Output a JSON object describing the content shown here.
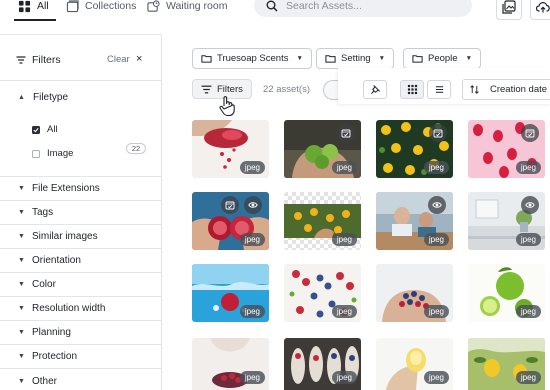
{
  "topbar": {
    "tabs": [
      {
        "label": "All",
        "icon": "grid-icon",
        "active": true
      },
      {
        "label": "Collections",
        "icon": "collections-icon"
      },
      {
        "label": "Waiting room",
        "icon": "waiting-room-icon"
      }
    ],
    "search_placeholder": "Search Assets...",
    "actions": [
      "gallery-icon",
      "cloud-upload-icon"
    ]
  },
  "sidebar": {
    "title": "Filters",
    "clear_label": "Clear",
    "close_symbol": "×",
    "filetype": {
      "label": "Filetype",
      "options": [
        {
          "label": "All",
          "checked": true
        },
        {
          "label": "Image",
          "checked": false,
          "count": "22"
        }
      ]
    },
    "items": [
      {
        "label": "File Extensions"
      },
      {
        "label": "Tags"
      },
      {
        "label": "Similar images"
      },
      {
        "label": "Orientation"
      },
      {
        "label": "Color"
      },
      {
        "label": "Resolution width"
      },
      {
        "label": "Planning"
      },
      {
        "label": "Protection"
      },
      {
        "label": "Other"
      }
    ]
  },
  "toolbar": {
    "collection_filters": [
      {
        "label": "Truesoap Scents"
      },
      {
        "label": "Setting"
      },
      {
        "label": "People"
      }
    ],
    "filters_button": "Filters",
    "asset_count": "22 asset(s)",
    "sort_label": "Creation date"
  },
  "grid": {
    "tiles": [
      {
        "badge": "jpeg",
        "subject": "pomegranate-seeds",
        "icons": []
      },
      {
        "badge": "jpeg",
        "subject": "limes-in-hands",
        "icons": [
          "calendar-check-icon"
        ]
      },
      {
        "badge": "jpeg",
        "subject": "lemons-on-green",
        "icons": [
          "calendar-check-icon"
        ]
      },
      {
        "badge": "jpeg",
        "subject": "strawberries-pattern",
        "icons": [
          "calendar-check-icon"
        ]
      },
      {
        "badge": "jpeg",
        "subject": "pomegranate-halves",
        "icons": [
          "calendar-check-icon",
          "eye-icon"
        ]
      },
      {
        "badge": "jpeg",
        "subject": "citrus-harvest",
        "icons": []
      },
      {
        "badge": "jpeg",
        "subject": "kitchen-scene",
        "icons": [
          "eye-icon"
        ]
      },
      {
        "badge": "jpeg",
        "subject": "bright-kitchen",
        "icons": [
          "eye-icon"
        ]
      },
      {
        "badge": "jpeg",
        "subject": "fruit-splash",
        "icons": []
      },
      {
        "badge": "jpeg",
        "subject": "berries-bowls",
        "icons": []
      },
      {
        "badge": "jpeg",
        "subject": "berries-in-hands",
        "icons": []
      },
      {
        "badge": "jpeg",
        "subject": "limes-halves",
        "icons": []
      },
      {
        "badge": "jpeg",
        "subject": "berry-bowl",
        "icons": []
      },
      {
        "badge": "jpeg",
        "subject": "berry-spoons",
        "icons": []
      },
      {
        "badge": "jpeg",
        "subject": "lemon-in-hand",
        "icons": []
      },
      {
        "badge": "jpeg",
        "subject": "lemon-tree",
        "icons": []
      }
    ]
  },
  "colors": {
    "accent": "#1f2329",
    "border": "#e3e5e9",
    "badge": "#4b5058"
  }
}
